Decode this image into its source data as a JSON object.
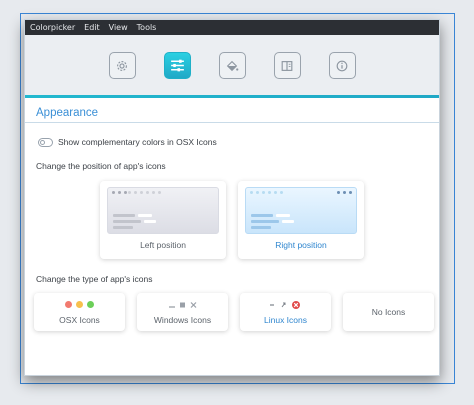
{
  "menubar": {
    "app_name": "Colorpicker",
    "items": [
      "Edit",
      "View",
      "Tools"
    ]
  },
  "toolbar": {
    "buttons": [
      {
        "icon": "gear-icon",
        "active": false
      },
      {
        "icon": "sliders-icon",
        "active": true
      },
      {
        "icon": "paint-bucket-icon",
        "active": false
      },
      {
        "icon": "book-icon",
        "active": false
      },
      {
        "icon": "info-icon",
        "active": false
      }
    ]
  },
  "colors": {
    "accent": "#22b8cf",
    "link": "#2f86cf",
    "menubar_bg": "#2c2f34"
  },
  "appearance": {
    "title": "Appearance",
    "toggle_label": "Show complementary colors in OSX Icons",
    "toggle_on": false,
    "position_label": "Change the position of app's icons",
    "positions": [
      {
        "label": "Left position",
        "selected": false
      },
      {
        "label": "Right position",
        "selected": true
      }
    ],
    "type_label": "Change the type of app's icons",
    "types": [
      {
        "label": "OSX Icons",
        "selected": false
      },
      {
        "label": "Windows Icons",
        "selected": false
      },
      {
        "label": "Linux Icons",
        "selected": true
      },
      {
        "label": "No Icons",
        "selected": false
      }
    ]
  }
}
